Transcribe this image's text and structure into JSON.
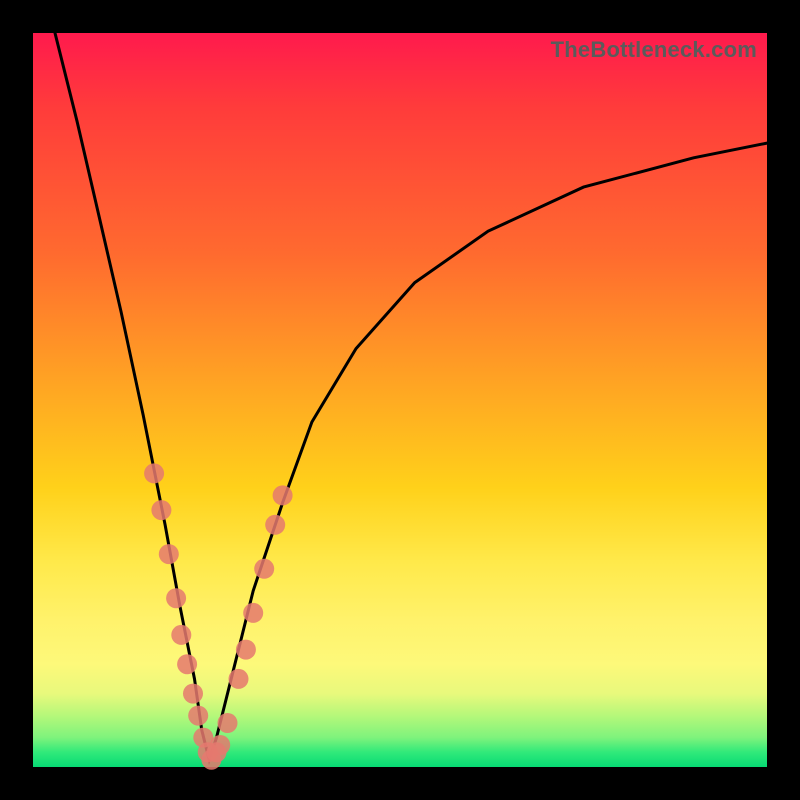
{
  "watermark": "TheBottleneck.com",
  "colors": {
    "gradient_top": "#ff1a4d",
    "gradient_mid1": "#ff6a2f",
    "gradient_mid2": "#ffd11a",
    "gradient_bottom": "#07da74",
    "curve": "#000000",
    "markers": "#e5796f",
    "frame": "#000000"
  },
  "chart_data": {
    "type": "line",
    "title": "",
    "xlabel": "",
    "ylabel": "",
    "xlim": [
      0,
      100
    ],
    "ylim": [
      0,
      100
    ],
    "note": "V-shaped bottleneck curve; x is component balance ratio (approx), y is bottleneck %. Minimum near x≈24.",
    "series": [
      {
        "name": "bottleneck-curve",
        "x": [
          3,
          6,
          9,
          12,
          15,
          18,
          20,
          22,
          23,
          24,
          25,
          27,
          30,
          34,
          38,
          44,
          52,
          62,
          75,
          90,
          100
        ],
        "y": [
          100,
          88,
          75,
          62,
          48,
          33,
          22,
          12,
          5,
          1,
          4,
          12,
          24,
          36,
          47,
          57,
          66,
          73,
          79,
          83,
          85
        ]
      }
    ],
    "markers": {
      "name": "sample-points",
      "note": "coral dots clustered near the valley of the V",
      "x": [
        16.5,
        17.5,
        18.5,
        19.5,
        20.2,
        21.0,
        21.8,
        22.5,
        23.2,
        23.8,
        24.3,
        25.0,
        25.5,
        26.5,
        28.0,
        29.0,
        30.0,
        31.5,
        33.0,
        34.0
      ],
      "y": [
        40,
        35,
        29,
        23,
        18,
        14,
        10,
        7,
        4,
        2,
        1,
        2,
        3,
        6,
        12,
        16,
        21,
        27,
        33,
        37
      ]
    }
  }
}
